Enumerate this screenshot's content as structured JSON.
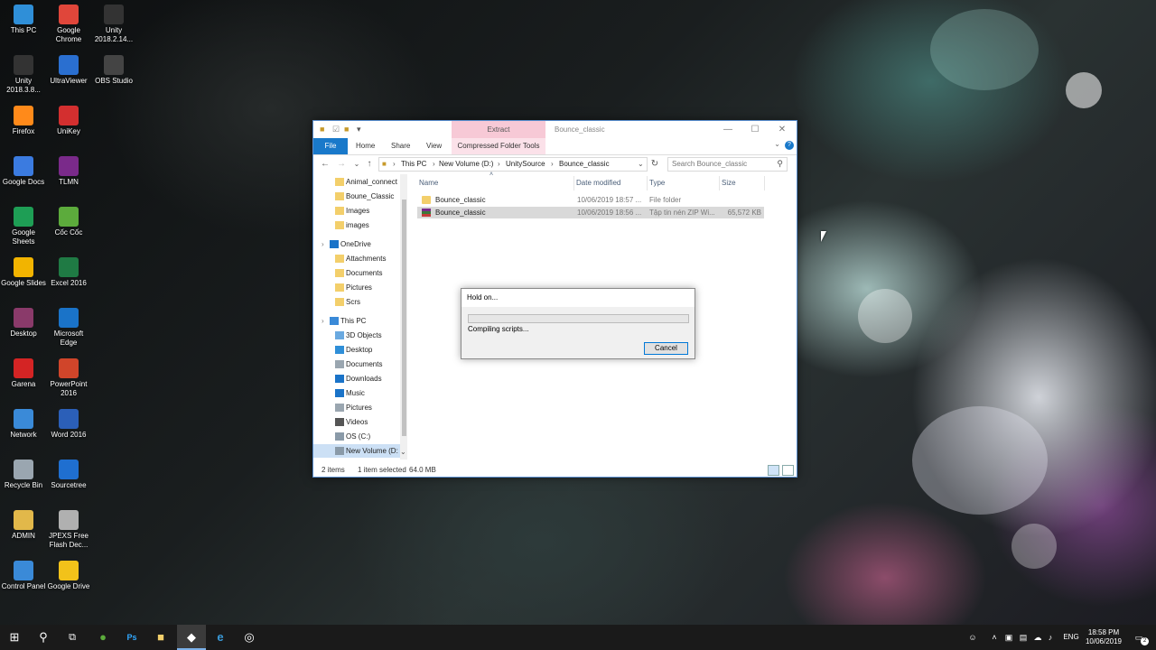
{
  "desktop": {
    "icons": [
      {
        "label": "This PC",
        "icon": "this-pc-icon",
        "color": "#2f8fd8"
      },
      {
        "label": "Google Chrome",
        "icon": "chrome-icon",
        "color": "#e0463a"
      },
      {
        "label": "Unity 2018.2.14...",
        "icon": "unity-icon",
        "color": "#333333"
      },
      {
        "label": "Unity 2018.3.8...",
        "icon": "unity-icon",
        "color": "#333333"
      },
      {
        "label": "UltraViewer",
        "icon": "ultraviewer-icon",
        "color": "#2a6fd0"
      },
      {
        "label": "OBS Studio",
        "icon": "obs-icon",
        "color": "#444444"
      },
      {
        "label": "Firefox",
        "icon": "firefox-icon",
        "color": "#ff8a1a"
      },
      {
        "label": "UniKey",
        "icon": "unikey-icon",
        "color": "#d32f2f"
      },
      {
        "label": "Google Docs",
        "icon": "google-docs-icon",
        "color": "#3b7be0"
      },
      {
        "label": "TLMN",
        "icon": "tlmn-icon",
        "color": "#7a2a8a"
      },
      {
        "label": "Google Sheets",
        "icon": "google-sheets-icon",
        "color": "#1e9e55"
      },
      {
        "label": "Cốc Cốc",
        "icon": "coccoc-icon",
        "color": "#5cab3c"
      },
      {
        "label": "Google Slides",
        "icon": "google-slides-icon",
        "color": "#f2b400"
      },
      {
        "label": "Excel 2016",
        "icon": "excel-icon",
        "color": "#1f7a44"
      },
      {
        "label": "Desktop",
        "icon": "winrar-icon",
        "color": "#8a3a6a"
      },
      {
        "label": "Microsoft Edge",
        "icon": "edge-icon",
        "color": "#1a73c8"
      },
      {
        "label": "Garena",
        "icon": "garena-icon",
        "color": "#d42424"
      },
      {
        "label": "PowerPoint 2016",
        "icon": "powerpoint-icon",
        "color": "#d0452a"
      },
      {
        "label": "Network",
        "icon": "network-icon",
        "color": "#3a8ad8"
      },
      {
        "label": "Word 2016",
        "icon": "word-icon",
        "color": "#2b5fb8"
      },
      {
        "label": "Recycle Bin",
        "icon": "recycle-bin-icon",
        "color": "#9aa6b0"
      },
      {
        "label": "Sourcetree",
        "icon": "sourcetree-icon",
        "color": "#1f6fd0"
      },
      {
        "label": "ADMIN",
        "icon": "user-folder-icon",
        "color": "#e2b84a"
      },
      {
        "label": "JPEXS Free Flash Dec...",
        "icon": "jpexs-icon",
        "color": "#b0b0b0"
      },
      {
        "label": "Control Panel",
        "icon": "control-panel-icon",
        "color": "#3a8ad8"
      },
      {
        "label": "Google Drive",
        "icon": "google-drive-icon",
        "color": "#f2c21a"
      }
    ]
  },
  "explorer": {
    "title": "Bounce_classic",
    "contextual_tab": "Extract",
    "ribbon_tabs": [
      "File",
      "Home",
      "Share",
      "View",
      "Compressed Folder Tools"
    ],
    "breadcrumb": [
      "This PC",
      "New Volume (D:)",
      "UnitySource",
      "Bounce_classic"
    ],
    "search_placeholder": "Search Bounce_classic",
    "nav": [
      {
        "label": "Animal_connect",
        "icon": "folder-icon"
      },
      {
        "label": "Boune_Classic",
        "icon": "folder-icon"
      },
      {
        "label": "Images",
        "icon": "folder-icon"
      },
      {
        "label": "images",
        "icon": "folder-icon"
      },
      {
        "label": "OneDrive",
        "icon": "onedrive-icon"
      },
      {
        "label": "Attachments",
        "icon": "folder-icon"
      },
      {
        "label": "Documents",
        "icon": "folder-icon"
      },
      {
        "label": "Pictures",
        "icon": "folder-icon"
      },
      {
        "label": "Scrs",
        "icon": "folder-icon"
      },
      {
        "label": "This PC",
        "icon": "this-pc-icon"
      },
      {
        "label": "3D Objects",
        "icon": "3d-objects-icon"
      },
      {
        "label": "Desktop",
        "icon": "desktop-folder-icon"
      },
      {
        "label": "Documents",
        "icon": "documents-icon"
      },
      {
        "label": "Downloads",
        "icon": "downloads-icon"
      },
      {
        "label": "Music",
        "icon": "music-icon"
      },
      {
        "label": "Pictures",
        "icon": "pictures-icon"
      },
      {
        "label": "Videos",
        "icon": "videos-icon"
      },
      {
        "label": "OS (C:)",
        "icon": "drive-icon"
      },
      {
        "label": "New Volume (D:",
        "icon": "drive-icon"
      }
    ],
    "columns": [
      "Name",
      "Date modified",
      "Type",
      "Size"
    ],
    "files": [
      {
        "name": "Bounce_classic",
        "date": "10/06/2019 18:57 ...",
        "type": "File folder",
        "size": "",
        "icon": "folder-icon"
      },
      {
        "name": "Bounce_classic",
        "date": "10/06/2019 18:56 ...",
        "type": "Tập tin nén ZIP Wi...",
        "size": "65,572 KB",
        "icon": "winrar-archive-icon"
      }
    ],
    "status": {
      "items": "2 items",
      "selected": "1 item selected",
      "size": "64.0 MB"
    }
  },
  "dialog": {
    "title": "Hold on...",
    "status": "Compiling scripts...",
    "progress_pct": 0,
    "cancel_label": "Cancel"
  },
  "taskbar": {
    "language": "ENG",
    "time": "18:58 PM",
    "date": "10/06/2019",
    "notifications": "2"
  }
}
